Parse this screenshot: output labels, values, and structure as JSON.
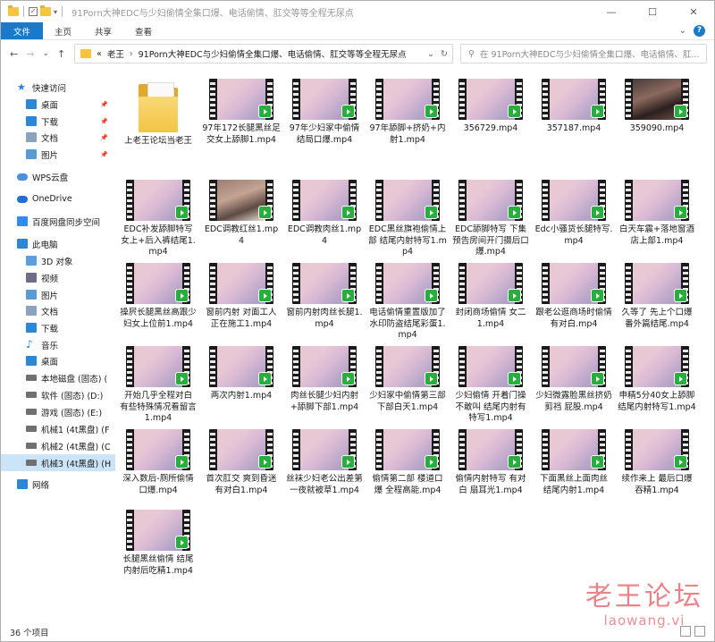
{
  "window": {
    "title": "91Porn大神EDC与少妇偷情全集口爆、电话偷情、肛交等等全程无尿点",
    "controls": {
      "minimize": "—",
      "maximize": "☐",
      "close": "✕"
    }
  },
  "ribbon": {
    "tabs": [
      "文件",
      "主页",
      "共享",
      "查看"
    ],
    "help": "?"
  },
  "address": {
    "back": "←",
    "forward": "→",
    "recent": "⌄",
    "up": "↑",
    "crumbs": [
      "«",
      "老王",
      "91Porn大神EDC与少妇偷情全集口爆、电话偷情、肛交等等全程无尿点"
    ],
    "separator": "›",
    "dropdown": "⌄",
    "refresh": "↻"
  },
  "search": {
    "placeholder": "在 91Porn大神EDC与少妇偷情全集口爆、电话偷情、肛..."
  },
  "sidebar": {
    "items": [
      {
        "label": "快速访问",
        "icon": "star-icon",
        "color": "#2f7ed8",
        "pinned": false
      },
      {
        "label": "桌面",
        "icon": "desktop-icon",
        "color": "#2b88d8",
        "pinned": true
      },
      {
        "label": "下载",
        "icon": "download-icon",
        "color": "#2b88d8",
        "pinned": true
      },
      {
        "label": "文档",
        "icon": "document-icon",
        "color": "#8aa4c0",
        "pinned": true
      },
      {
        "label": "图片",
        "icon": "pictures-icon",
        "color": "#5b9bd5",
        "pinned": true
      },
      {
        "label": "WPS云盘",
        "icon": "cloud-icon",
        "color": "#4a8fe0",
        "pinned": false
      },
      {
        "label": "OneDrive",
        "icon": "onedrive-icon",
        "color": "#1e6fd9",
        "pinned": false
      },
      {
        "label": "百度网盘同步空间",
        "icon": "baidu-icon",
        "color": "#2d8cf0",
        "pinned": false
      },
      {
        "label": "此电脑",
        "icon": "computer-icon",
        "color": "#2b88d8",
        "pinned": false
      },
      {
        "label": "3D 对象",
        "icon": "3d-objects-icon",
        "color": "#5aa0e0",
        "pinned": false
      },
      {
        "label": "视频",
        "icon": "video-icon",
        "color": "#6d6d8a",
        "pinned": false
      },
      {
        "label": "图片",
        "icon": "pictures-icon",
        "color": "#5b9bd5",
        "pinned": false
      },
      {
        "label": "文档",
        "icon": "document-icon",
        "color": "#8aa4c0",
        "pinned": false
      },
      {
        "label": "下载",
        "icon": "download-icon",
        "color": "#2b88d8",
        "pinned": false
      },
      {
        "label": "音乐",
        "icon": "music-icon",
        "color": "#2b88d8",
        "pinned": false
      },
      {
        "label": "桌面",
        "icon": "desktop-icon",
        "color": "#2b88d8",
        "pinned": false
      },
      {
        "label": "本地磁盘 (固态) (",
        "icon": "drive-icon",
        "color": "#707070",
        "pinned": false
      },
      {
        "label": "软件 (固态) (D:)",
        "icon": "drive-icon",
        "color": "#707070",
        "pinned": false
      },
      {
        "label": "游戏 (固态) (E:)",
        "icon": "drive-icon",
        "color": "#707070",
        "pinned": false
      },
      {
        "label": "机械1 (4t黑盘) (F",
        "icon": "drive-icon",
        "color": "#707070",
        "pinned": false
      },
      {
        "label": "机械2 (4t黑盘) (C",
        "icon": "drive-icon",
        "color": "#707070",
        "pinned": false
      },
      {
        "label": "机械3 (4t黑盘) (H",
        "icon": "drive-icon",
        "color": "#707070",
        "pinned": false
      },
      {
        "label": "网络",
        "icon": "network-icon",
        "color": "#2b88d8",
        "pinned": false
      }
    ]
  },
  "files": [
    {
      "name": "上老王论坛当老王",
      "type": "folder"
    },
    {
      "name": "97年172长腿黑丝足交女上舔脚1.mp4",
      "type": "video"
    },
    {
      "name": "97年少妇家中偷情结局口爆.mp4",
      "type": "video"
    },
    {
      "name": "97年舔脚+挤奶+内射1.mp4",
      "type": "video"
    },
    {
      "name": "356729.mp4",
      "type": "video"
    },
    {
      "name": "357187.mp4",
      "type": "video"
    },
    {
      "name": "359090.mp4",
      "type": "video",
      "thumb": "dark"
    },
    {
      "name": "EDC补发舔脚特写 女上+后入裤结尾1.mp4",
      "type": "video"
    },
    {
      "name": "EDC调教红丝1.mp4",
      "type": "video",
      "thumb": "dark2"
    },
    {
      "name": "EDC调教肉丝1.mp4",
      "type": "video"
    },
    {
      "name": "EDC黑丝旗袍偷情上部 结尾内射特写1.mp4",
      "type": "video"
    },
    {
      "name": "EDC舔脚特写 下集预告房间开门摄后口爆.mp4",
      "type": "video"
    },
    {
      "name": "Edc小骚货长腿特写.mp4",
      "type": "video"
    },
    {
      "name": "白天车震+落地窗酒店上部1.mp4",
      "type": "video"
    },
    {
      "name": "操屄长腿黑丝高跟少妇女上位前1.mp4",
      "type": "video"
    },
    {
      "name": "窗前内射 对面工人正在施工1.mp4",
      "type": "video"
    },
    {
      "name": "窗前内射肉丝长腿1.mp4",
      "type": "video"
    },
    {
      "name": "电话偷情重置版加了水印防盗结尾彩蛋1.mp4",
      "type": "video"
    },
    {
      "name": "封闭商场偷情 女二1.mp4",
      "type": "video"
    },
    {
      "name": "跟老公逛商场时偷情 有对白.mp4",
      "type": "video"
    },
    {
      "name": "久等了 先上个口爆番外篇结尾.mp4",
      "type": "video"
    },
    {
      "name": "开始几乎全程对白 有些特殊情况看留言1.mp4",
      "type": "video"
    },
    {
      "name": "两次内射1.mp4",
      "type": "video"
    },
    {
      "name": "肉丝长腿少妇内射+舔脚下部1.mp4",
      "type": "video"
    },
    {
      "name": "少妇家中偷情第三部 下部白天1.mp4",
      "type": "video"
    },
    {
      "name": "少妇偷情 开着门操不敢叫 结尾内射有特写1.mp4",
      "type": "video"
    },
    {
      "name": "少妇微露脸黑丝挤奶剪裆 屁股.mp4",
      "type": "video"
    },
    {
      "name": "申精5分40女上舔脚结尾内射特写1.mp4",
      "type": "video"
    },
    {
      "name": "深入数后-厕所偷情口爆.mp4",
      "type": "video"
    },
    {
      "name": "首次肛交 爽到昏迷 有对白1.mp4",
      "type": "video"
    },
    {
      "name": "丝袜少妇老公出差第一夜就被草1.mp4",
      "type": "video"
    },
    {
      "name": "偷情第二部 楼道口爆 全程高能.mp4",
      "type": "video"
    },
    {
      "name": "偷情内射特写 有对白 扇耳光1.mp4",
      "type": "video"
    },
    {
      "name": "下面黑丝上面肉丝 结尾内射1.mp4",
      "type": "video"
    },
    {
      "name": "续作来上 最后口爆吞精1.mp4",
      "type": "video"
    },
    {
      "name": "长腿黑丝偷情 结尾内射后吃精1.mp4",
      "type": "video"
    }
  ],
  "status": {
    "count": "36 个项目"
  },
  "watermark": {
    "cn": "老王论坛",
    "en": "laowang.vi"
  }
}
